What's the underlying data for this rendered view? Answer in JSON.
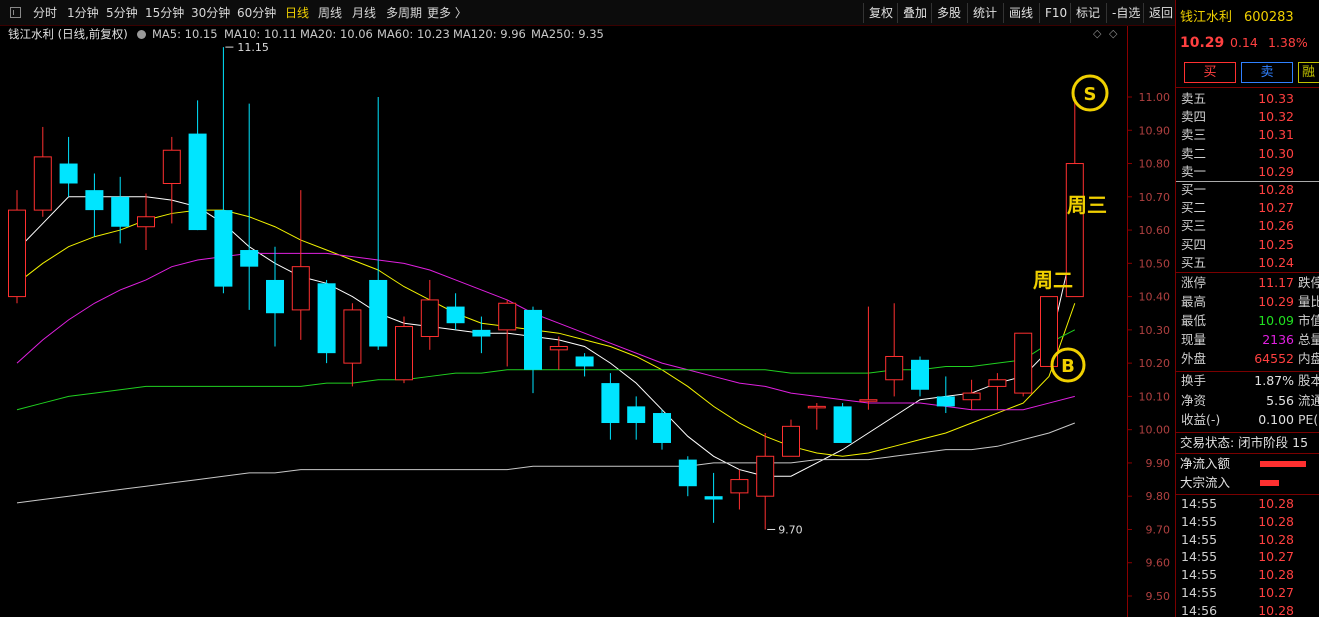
{
  "toolbar": {
    "left": [
      "分时",
      "1分钟",
      "5分钟",
      "15分钟",
      "30分钟",
      "60分钟",
      "日线",
      "周线",
      "月线",
      "多周期",
      "更多 〉"
    ],
    "active": "日线",
    "right": [
      "复权",
      "叠加",
      "多股",
      "统计",
      "画线",
      "F10",
      "标记",
      "-自选",
      "返回"
    ]
  },
  "chart": {
    "title": "钱江水利 (日线,前复权)",
    "ma": [
      {
        "label": "MA5: 10.15",
        "color": "#ffffff"
      },
      {
        "label": "MA10: 10.11",
        "color": "#f2f200"
      },
      {
        "label": "MA20: 10.06",
        "color": "#e020e0"
      },
      {
        "label": "MA60: 10.23",
        "color": "#20d020"
      },
      {
        "label": "MA120: 9.96",
        "color": "#c8c8c8"
      },
      {
        "label": "MA250: 9.35",
        "color": "#3050ff"
      }
    ],
    "high_label": "11.15",
    "low_label": "9.70",
    "annotations": {
      "s": "S",
      "b": "B",
      "wed": "周三",
      "tue": "周二"
    }
  },
  "chart_data": {
    "type": "candlestick",
    "ylim": [
      9.41,
      11.26
    ],
    "yticks": [
      "11.00",
      "10.90",
      "10.80",
      "10.70",
      "10.60",
      "10.50",
      "10.40",
      "10.30",
      "10.20",
      "10.10",
      "10.00",
      "9.90",
      "9.80",
      "9.70",
      "9.60",
      "9.50"
    ],
    "candles": [
      {
        "o": 10.4,
        "c": 10.66,
        "h": 10.72,
        "l": 10.38
      },
      {
        "o": 10.66,
        "c": 10.82,
        "h": 10.91,
        "l": 10.64
      },
      {
        "o": 10.8,
        "c": 10.74,
        "h": 10.88,
        "l": 10.7
      },
      {
        "o": 10.72,
        "c": 10.66,
        "h": 10.77,
        "l": 10.58
      },
      {
        "o": 10.7,
        "c": 10.61,
        "h": 10.76,
        "l": 10.56
      },
      {
        "o": 10.61,
        "c": 10.64,
        "h": 10.71,
        "l": 10.54
      },
      {
        "o": 10.74,
        "c": 10.84,
        "h": 10.88,
        "l": 10.62
      },
      {
        "o": 10.89,
        "c": 10.6,
        "h": 10.99,
        "l": 10.6
      },
      {
        "o": 10.66,
        "c": 10.43,
        "h": 11.15,
        "l": 10.41
      },
      {
        "o": 10.54,
        "c": 10.49,
        "h": 10.98,
        "l": 10.36
      },
      {
        "o": 10.45,
        "c": 10.35,
        "h": 10.55,
        "l": 10.25
      },
      {
        "o": 10.36,
        "c": 10.49,
        "h": 10.72,
        "l": 10.27
      },
      {
        "o": 10.44,
        "c": 10.23,
        "h": 10.45,
        "l": 10.2
      },
      {
        "o": 10.2,
        "c": 10.36,
        "h": 10.38,
        "l": 10.13
      },
      {
        "o": 10.45,
        "c": 10.25,
        "h": 11.0,
        "l": 10.24
      },
      {
        "o": 10.15,
        "c": 10.31,
        "h": 10.34,
        "l": 10.14
      },
      {
        "o": 10.28,
        "c": 10.39,
        "h": 10.45,
        "l": 10.24
      },
      {
        "o": 10.37,
        "c": 10.32,
        "h": 10.41,
        "l": 10.3
      },
      {
        "o": 10.3,
        "c": 10.28,
        "h": 10.34,
        "l": 10.23
      },
      {
        "o": 10.3,
        "c": 10.38,
        "h": 10.39,
        "l": 10.19
      },
      {
        "o": 10.36,
        "c": 10.18,
        "h": 10.37,
        "l": 10.11
      },
      {
        "o": 10.24,
        "c": 10.25,
        "h": 10.28,
        "l": 10.18
      },
      {
        "o": 10.22,
        "c": 10.19,
        "h": 10.23,
        "l": 10.16
      },
      {
        "o": 10.14,
        "c": 10.02,
        "h": 10.17,
        "l": 9.97
      },
      {
        "o": 10.07,
        "c": 10.02,
        "h": 10.1,
        "l": 9.97
      },
      {
        "o": 10.05,
        "c": 9.96,
        "h": 10.06,
        "l": 9.94
      },
      {
        "o": 9.91,
        "c": 9.83,
        "h": 9.92,
        "l": 9.8
      },
      {
        "o": 9.8,
        "c": 9.79,
        "h": 9.87,
        "l": 9.72
      },
      {
        "o": 9.81,
        "c": 9.85,
        "h": 9.88,
        "l": 9.76
      },
      {
        "o": 9.8,
        "c": 9.92,
        "h": 9.99,
        "l": 9.7
      },
      {
        "o": 9.92,
        "c": 10.01,
        "h": 10.03,
        "l": 9.92
      },
      {
        "o": 10.07,
        "c": 10.07,
        "h": 10.08,
        "l": 10.0
      },
      {
        "o": 10.07,
        "c": 9.96,
        "h": 10.08,
        "l": 9.96
      },
      {
        "o": 10.09,
        "c": 10.09,
        "h": 10.37,
        "l": 10.06
      },
      {
        "o": 10.15,
        "c": 10.22,
        "h": 10.38,
        "l": 10.1
      },
      {
        "o": 10.21,
        "c": 10.12,
        "h": 10.22,
        "l": 10.1
      },
      {
        "o": 10.1,
        "c": 10.07,
        "h": 10.16,
        "l": 10.05
      },
      {
        "o": 10.09,
        "c": 10.11,
        "h": 10.15,
        "l": 10.06
      },
      {
        "o": 10.13,
        "c": 10.15,
        "h": 10.17,
        "l": 10.06
      },
      {
        "o": 10.11,
        "c": 10.29,
        "h": 10.29,
        "l": 10.1
      },
      {
        "o": 10.19,
        "c": 10.4,
        "h": 10.4,
        "l": 10.19
      },
      {
        "o": 10.4,
        "c": 10.8,
        "h": 11.0,
        "l": 10.4
      }
    ],
    "ma_lines": [
      {
        "name": "MA5",
        "color": "#ffffff",
        "values": [
          10.54,
          10.62,
          10.7,
          10.7,
          10.7,
          10.7,
          10.69,
          10.67,
          10.62,
          10.55,
          10.5,
          10.46,
          10.44,
          10.4,
          10.35,
          10.32,
          10.31,
          10.3,
          10.29,
          10.29,
          10.28,
          10.27,
          10.25,
          10.2,
          10.14,
          10.06,
          9.98,
          9.92,
          9.88,
          9.86,
          9.86,
          9.9,
          9.94,
          9.99,
          10.04,
          10.09,
          10.1,
          10.11,
          10.14,
          10.16,
          10.24,
          10.58
        ]
      },
      {
        "name": "MA10",
        "color": "#f2f200",
        "values": [
          10.44,
          10.5,
          10.55,
          10.58,
          10.6,
          10.63,
          10.65,
          10.66,
          10.66,
          10.64,
          10.61,
          10.57,
          10.54,
          10.51,
          10.48,
          10.43,
          10.39,
          10.35,
          10.32,
          10.31,
          10.3,
          10.29,
          10.27,
          10.25,
          10.22,
          10.18,
          10.13,
          10.07,
          10.02,
          9.98,
          9.95,
          9.93,
          9.92,
          9.93,
          9.95,
          9.97,
          9.99,
          10.02,
          10.05,
          10.08,
          10.16,
          10.38
        ]
      },
      {
        "name": "MA20",
        "color": "#e020e0",
        "values": [
          10.2,
          10.27,
          10.33,
          10.38,
          10.42,
          10.45,
          10.49,
          10.51,
          10.52,
          10.53,
          10.53,
          10.53,
          10.53,
          10.52,
          10.51,
          10.5,
          10.48,
          10.45,
          10.42,
          10.39,
          10.35,
          10.32,
          10.29,
          10.26,
          10.23,
          10.2,
          10.18,
          10.16,
          10.14,
          10.13,
          10.11,
          10.1,
          10.09,
          10.08,
          10.08,
          10.08,
          10.07,
          10.06,
          10.06,
          10.06,
          10.08,
          10.1
        ]
      },
      {
        "name": "MA60",
        "color": "#20d020",
        "values": [
          10.06,
          10.08,
          10.1,
          10.11,
          10.12,
          10.13,
          10.13,
          10.13,
          10.13,
          10.13,
          10.13,
          10.13,
          10.14,
          10.14,
          10.15,
          10.15,
          10.16,
          10.17,
          10.17,
          10.18,
          10.18,
          10.18,
          10.18,
          10.18,
          10.18,
          10.18,
          10.18,
          10.18,
          10.18,
          10.18,
          10.17,
          10.17,
          10.17,
          10.17,
          10.18,
          10.18,
          10.19,
          10.19,
          10.2,
          10.21,
          10.26,
          10.3
        ]
      },
      {
        "name": "MA120",
        "color": "#c8c8c8",
        "values": [
          9.78,
          9.79,
          9.8,
          9.81,
          9.82,
          9.83,
          9.84,
          9.85,
          9.86,
          9.87,
          9.87,
          9.88,
          9.88,
          9.88,
          9.88,
          9.88,
          9.88,
          9.88,
          9.88,
          9.88,
          9.89,
          9.89,
          9.89,
          9.89,
          9.89,
          9.89,
          9.89,
          9.9,
          9.9,
          9.9,
          9.9,
          9.91,
          9.91,
          9.91,
          9.92,
          9.93,
          9.94,
          9.94,
          9.95,
          9.97,
          9.99,
          10.02
        ]
      }
    ]
  },
  "panel": {
    "name": "钱江水利",
    "code": "600283",
    "price": "10.29",
    "change": "0.14",
    "pct": "1.38%",
    "buy_btn": "买",
    "sell_btn": "卖",
    "third_btn": "融",
    "asks": [
      {
        "l": "卖五",
        "p": "10.33"
      },
      {
        "l": "卖四",
        "p": "10.32"
      },
      {
        "l": "卖三",
        "p": "10.31"
      },
      {
        "l": "卖二",
        "p": "10.30"
      },
      {
        "l": "卖一",
        "p": "10.29"
      }
    ],
    "bids": [
      {
        "l": "买一",
        "p": "10.28"
      },
      {
        "l": "买二",
        "p": "10.27"
      },
      {
        "l": "买三",
        "p": "10.26"
      },
      {
        "l": "买四",
        "p": "10.25"
      },
      {
        "l": "买五",
        "p": "10.24"
      }
    ],
    "stats": [
      {
        "l": "涨停",
        "v": "11.17",
        "vc": "#ff4040",
        "l2": "跌停"
      },
      {
        "l": "最高",
        "v": "10.29",
        "vc": "#ff4040",
        "l2": "量比"
      },
      {
        "l": "最低",
        "v": "10.09",
        "vc": "#20e020",
        "l2": "市值"
      },
      {
        "l": "现量",
        "v": "2136",
        "vc": "#e020e0",
        "l2": "总量"
      },
      {
        "l": "外盘",
        "v": "64552",
        "vc": "#ff4040",
        "l2": "内盘"
      }
    ],
    "stats2": [
      {
        "l": "换手",
        "v": "1.87%",
        "vc": "#e0e0e0",
        "l2": "股本"
      },
      {
        "l": "净资",
        "v": "5.56",
        "vc": "#e0e0e0",
        "l2": "流通"
      },
      {
        "l": "收益(-)",
        "v": "0.100",
        "vc": "#e0e0e0",
        "l2": "PE(动)"
      }
    ],
    "trade_status": "交易状态: 闭市阶段 15",
    "flow": [
      {
        "l": "净流入额"
      },
      {
        "l": "大宗流入"
      }
    ],
    "ticks": [
      {
        "t": "14:55",
        "p": "10.28"
      },
      {
        "t": "14:55",
        "p": "10.28"
      },
      {
        "t": "14:55",
        "p": "10.28"
      },
      {
        "t": "14:55",
        "p": "10.27"
      },
      {
        "t": "14:55",
        "p": "10.28"
      },
      {
        "t": "14:55",
        "p": "10.27"
      },
      {
        "t": "14:56",
        "p": "10.28"
      }
    ]
  }
}
